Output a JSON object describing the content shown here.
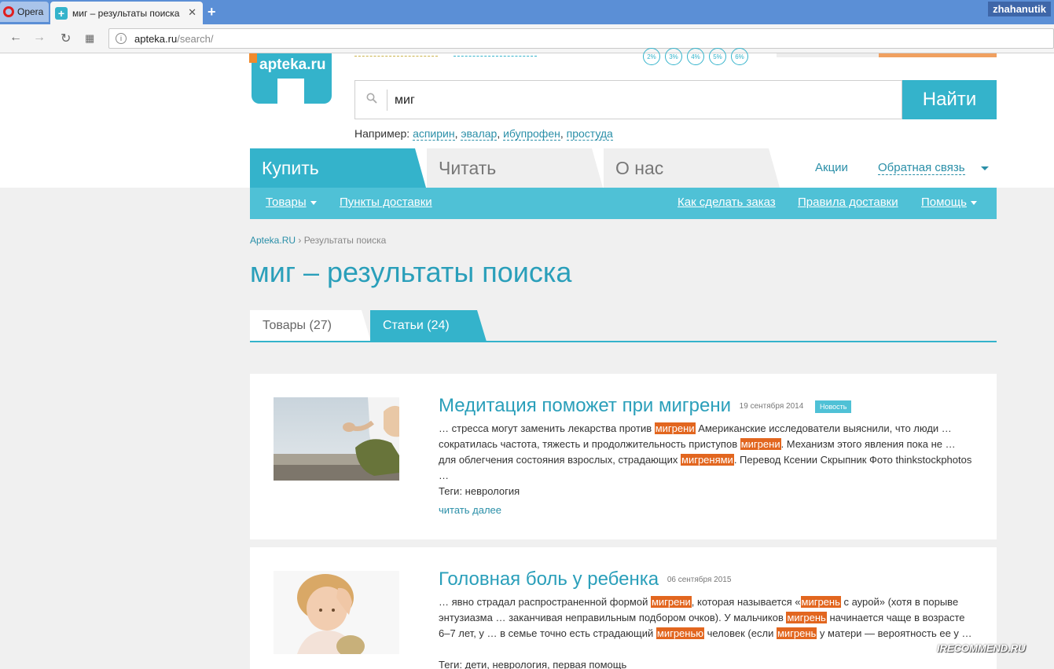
{
  "browser": {
    "opera_tab_label": "Opera",
    "tab_title": "миг – результаты поиска",
    "tab_close": "✕",
    "new_tab": "+",
    "user": "zhahanutik",
    "url_host": "apteka.ru",
    "url_path": "/search/"
  },
  "header": {
    "logo_text": "apteka.ru",
    "discounts": [
      "2%",
      "3%",
      "4%",
      "5%",
      "6%"
    ],
    "search_value": "миг",
    "search_button": "Найти",
    "examples_prefix": "Например:",
    "examples": [
      "аспирин",
      "эвалар",
      "ибупрофен",
      "простуда"
    ]
  },
  "nav": {
    "tabs": [
      "Купить",
      "Читать",
      "О нас"
    ],
    "promo": "Акции",
    "feedback": "Обратная связь",
    "sub": {
      "goods": "Товары",
      "pickup": "Пункты доставки",
      "how_to_order": "Как сделать заказ",
      "delivery_rules": "Правила доставки",
      "help": "Помощь"
    }
  },
  "breadcrumb": {
    "home": "Apteka.RU",
    "sep": "›",
    "current": "Результаты поиска"
  },
  "page_title": "миг – результаты поиска",
  "result_tabs": {
    "goods": "Товары (27)",
    "articles": "Статьи (24)"
  },
  "articles": [
    {
      "title": "Медитация поможет при мигрени",
      "date": "19 сентября 2014",
      "badge": "Новость",
      "p1": "… стресса могут заменить лекарства против ",
      "h1": "мигрени",
      "p2": " Американские исследователи выяснили, что люди … сократилась частота, тяжесть и продолжительность приступов ",
      "h2": "мигрени",
      "p3": ". Механизм этого явления пока не … для облегчения состояния взрослых, страдающих ",
      "h3": "мигренями",
      "p4": ". Перевод Ксении Скрыпник Фото thinkstockphotos …",
      "tags": "Теги: неврология",
      "read_more": "читать далее"
    },
    {
      "title": "Головная боль у ребенка",
      "date": "06 сентября 2015",
      "p1": "… явно страдал распространенной формой ",
      "h1": "мигрени",
      "p2": ", которая называется «",
      "h2": "мигрень",
      "p3": " с аурой» (хотя в порыве энтузиазма … заканчивая неправильным подбором очков). У мальчиков ",
      "h3": "мигрень",
      "p4": " начинается чаще в возрасте 6–7 лет, у … в семье точно есть страдающий ",
      "h4": "мигренью",
      "p5": " человек (если ",
      "h5": "мигрень",
      "p6": " у матери — вероятность ее у …",
      "tags": "Теги: дети, неврология, первая помощь"
    }
  ],
  "watermark": "IRECOMMEND.RU"
}
